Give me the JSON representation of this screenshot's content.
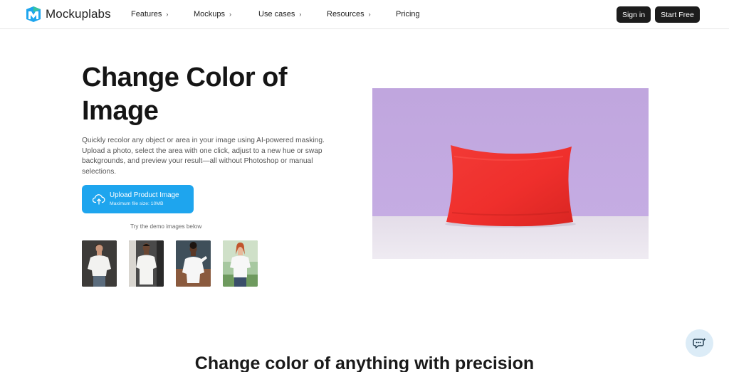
{
  "brand": {
    "name": "Mockuplabs",
    "accent": "#1ea5ee",
    "logo_colors": [
      "#1ea5ee",
      "#37c4a0",
      "#0f6fb3"
    ]
  },
  "nav": {
    "items": [
      {
        "label": "Features",
        "has_chevron": true
      },
      {
        "label": "Mockups",
        "has_chevron": true
      },
      {
        "label": "Use cases",
        "has_chevron": true
      },
      {
        "label": "Resources",
        "has_chevron": true
      },
      {
        "label": "Pricing",
        "has_chevron": false
      }
    ],
    "chevron_icon": "chevron-right-icon",
    "sign_in": "Sign in",
    "start_free": "Start Free"
  },
  "hero": {
    "title": "Change Color of Image",
    "description": "Quickly recolor any object or area in your image using AI-powered masking. Upload a photo, select the area with one click, adjust to a new hue or swap backgrounds, and preview your result—all without Photoshop or manual selections.",
    "upload_label": "Upload Product Image",
    "upload_sub": "Maximum file size: 10MB",
    "upload_icon": "cloud-upload-icon",
    "demo_caption": "Try the demo images below",
    "demo_images": [
      "demo-man-white-tshirt",
      "demo-man-long-white-tshirt",
      "demo-man-white-hoodie",
      "demo-woman-white-tshirt"
    ],
    "preview": {
      "subject": "red pillow",
      "pillow_color": "#f0302f",
      "wall_color": "#c2a9e0",
      "floor_color": "#e9e2ee"
    }
  },
  "section": {
    "title": "Change color of anything with precision"
  },
  "chat": {
    "icon": "chat-bubble-icon"
  }
}
